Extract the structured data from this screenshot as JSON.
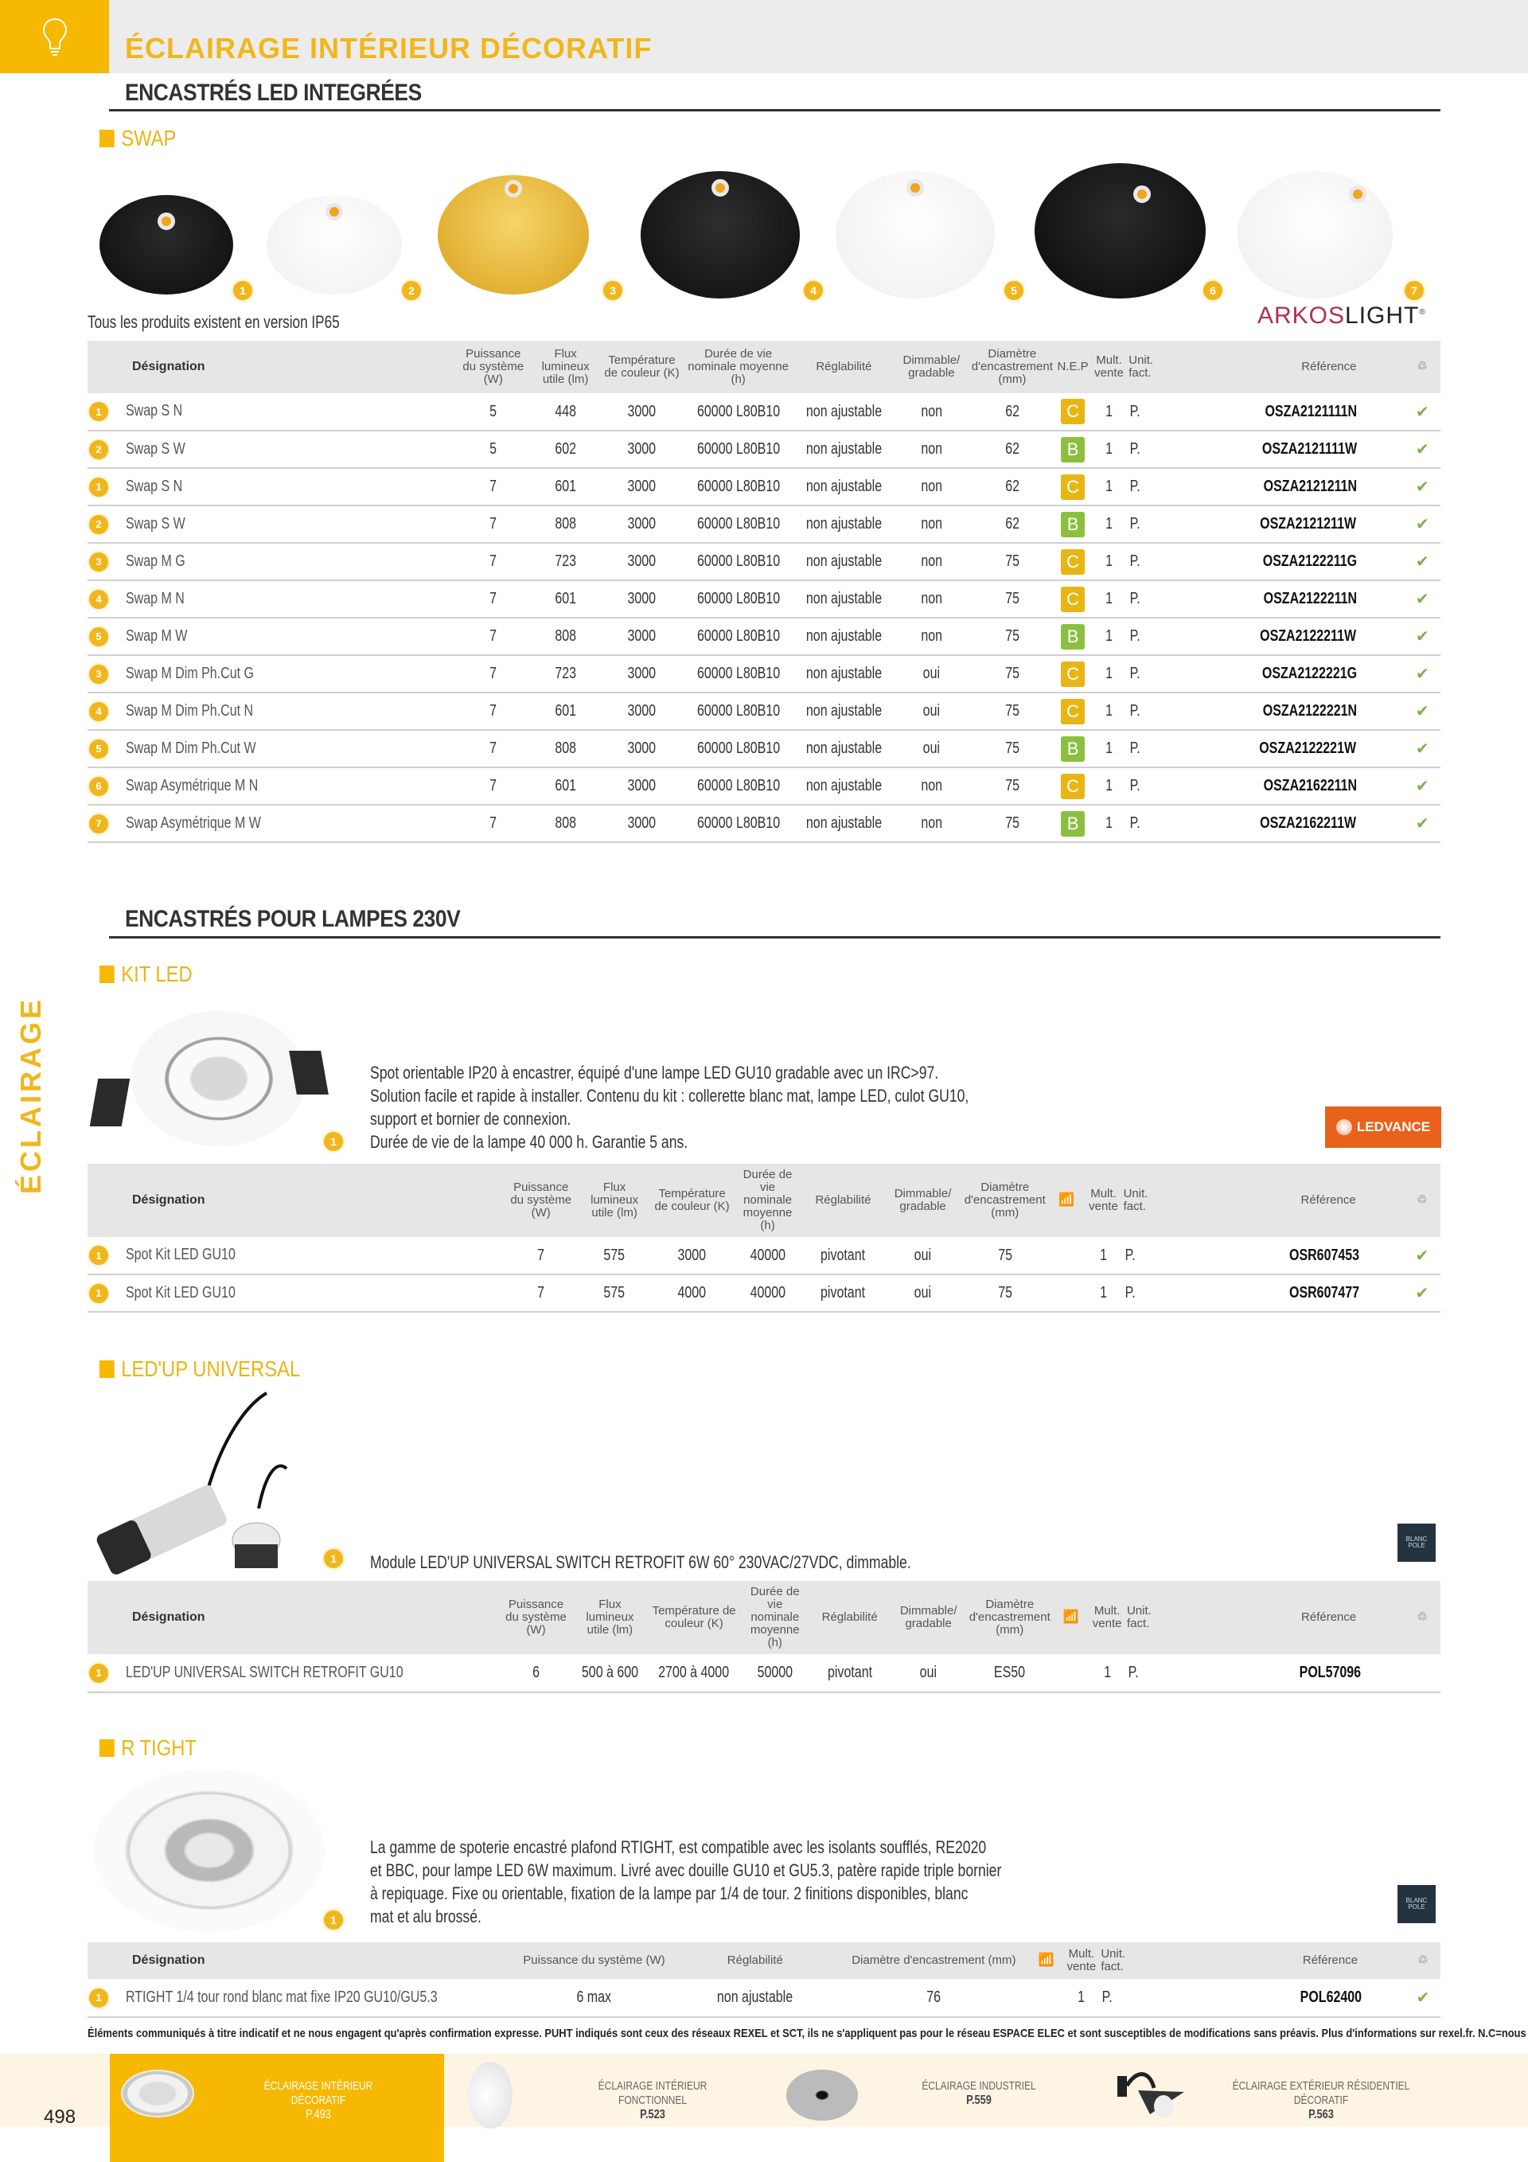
{
  "header": {
    "title": "ÉCLAIRAGE INTÉRIEUR DÉCORATIF",
    "icon": "lightbulb-icon",
    "side_label": "ÉCLAIRAGE"
  },
  "section1": {
    "title": "ENCASTRÉS LED INTEGRÉES",
    "swap": {
      "title": "SWAP",
      "brand": "ARKOSLIGHT",
      "brand_part1": "ARKOS",
      "brand_part2": "LIGHT",
      "note": "Tous les produits existent en version IP65",
      "image_badges": [
        "1",
        "2",
        "3",
        "4",
        "5",
        "6",
        "7"
      ],
      "headers": {
        "designation": "Désignation",
        "power": "Puissance du système (W)",
        "flux": "Flux lumineux utile (lm)",
        "temp": "Température de couleur (K)",
        "life": "Durée de vie nominale moyenne (h)",
        "adjust": "Réglabilité",
        "dim": "Dimmable/ gradable",
        "diam": "Diamètre d'encastrement (mm)",
        "nep": "N.E.P",
        "mult": "Mult. vente",
        "unit": "Unit. fact.",
        "ref": "Référence",
        "stock_icon": "stock-icon"
      },
      "rows": [
        {
          "n": "1",
          "name": "Swap S N",
          "power": "5",
          "flux": "448",
          "temp": "3000",
          "life": "60000 L80B10",
          "adjust": "non ajustable",
          "dim": "non",
          "diam": "62",
          "nep": "C",
          "mult": "1",
          "unit": "P.",
          "ref": "OSZA2121111N",
          "stock": "✔"
        },
        {
          "n": "2",
          "name": "Swap S W",
          "power": "5",
          "flux": "602",
          "temp": "3000",
          "life": "60000 L80B10",
          "adjust": "non ajustable",
          "dim": "non",
          "diam": "62",
          "nep": "B",
          "mult": "1",
          "unit": "P.",
          "ref": "OSZA2121111W",
          "stock": "✔"
        },
        {
          "n": "1",
          "name": "Swap S N",
          "power": "7",
          "flux": "601",
          "temp": "3000",
          "life": "60000 L80B10",
          "adjust": "non ajustable",
          "dim": "non",
          "diam": "62",
          "nep": "C",
          "mult": "1",
          "unit": "P.",
          "ref": "OSZA2121211N",
          "stock": "✔"
        },
        {
          "n": "2",
          "name": "Swap S W",
          "power": "7",
          "flux": "808",
          "temp": "3000",
          "life": "60000 L80B10",
          "adjust": "non ajustable",
          "dim": "non",
          "diam": "62",
          "nep": "B",
          "mult": "1",
          "unit": "P.",
          "ref": "OSZA2121211W",
          "stock": "✔"
        },
        {
          "n": "3",
          "name": "Swap M G",
          "power": "7",
          "flux": "723",
          "temp": "3000",
          "life": "60000 L80B10",
          "adjust": "non ajustable",
          "dim": "non",
          "diam": "75",
          "nep": "C",
          "mult": "1",
          "unit": "P.",
          "ref": "OSZA2122211G",
          "stock": "✔"
        },
        {
          "n": "4",
          "name": "Swap M N",
          "power": "7",
          "flux": "601",
          "temp": "3000",
          "life": "60000 L80B10",
          "adjust": "non ajustable",
          "dim": "non",
          "diam": "75",
          "nep": "C",
          "mult": "1",
          "unit": "P.",
          "ref": "OSZA2122211N",
          "stock": "✔"
        },
        {
          "n": "5",
          "name": "Swap M W",
          "power": "7",
          "flux": "808",
          "temp": "3000",
          "life": "60000 L80B10",
          "adjust": "non ajustable",
          "dim": "non",
          "diam": "75",
          "nep": "B",
          "mult": "1",
          "unit": "P.",
          "ref": "OSZA2122211W",
          "stock": "✔"
        },
        {
          "n": "3",
          "name": "Swap M Dim Ph.Cut  G",
          "power": "7",
          "flux": "723",
          "temp": "3000",
          "life": "60000 L80B10",
          "adjust": "non ajustable",
          "dim": "oui",
          "diam": "75",
          "nep": "C",
          "mult": "1",
          "unit": "P.",
          "ref": "OSZA2122221G",
          "stock": "✔"
        },
        {
          "n": "4",
          "name": "Swap M Dim Ph.Cut  N",
          "power": "7",
          "flux": "601",
          "temp": "3000",
          "life": "60000 L80B10",
          "adjust": "non ajustable",
          "dim": "oui",
          "diam": "75",
          "nep": "C",
          "mult": "1",
          "unit": "P.",
          "ref": "OSZA2122221N",
          "stock": "✔"
        },
        {
          "n": "5",
          "name": "Swap M Dim Ph.Cut W",
          "power": "7",
          "flux": "808",
          "temp": "3000",
          "life": "60000 L80B10",
          "adjust": "non ajustable",
          "dim": "oui",
          "diam": "75",
          "nep": "B",
          "mult": "1",
          "unit": "P.",
          "ref": "OSZA2122221W",
          "stock": "✔"
        },
        {
          "n": "6",
          "name": "Swap Asymétrique M  N",
          "power": "7",
          "flux": "601",
          "temp": "3000",
          "life": "60000 L80B10",
          "adjust": "non ajustable",
          "dim": "non",
          "diam": "75",
          "nep": "C",
          "mult": "1",
          "unit": "P.",
          "ref": "OSZA2162211N",
          "stock": "✔"
        },
        {
          "n": "7",
          "name": "Swap Asymétrique M W",
          "power": "7",
          "flux": "808",
          "temp": "3000",
          "life": "60000 L80B10",
          "adjust": "non ajustable",
          "dim": "non",
          "diam": "75",
          "nep": "B",
          "mult": "1",
          "unit": "P.",
          "ref": "OSZA2162211W",
          "stock": "✔"
        }
      ]
    }
  },
  "section2": {
    "title": "ENCASTRÉS POUR LAMPES 230V",
    "kit_led": {
      "title": "KIT LED",
      "brand": "LEDVANCE",
      "badge": "1",
      "description": [
        "Spot orientable IP20 à encastrer, équipé d'une lampe LED GU10 gradable avec un IRC>97.",
        "Solution facile et rapide à installer. Contenu du kit : collerette blanc mat, lampe LED, culot GU10,",
        "support et bornier de connexion.",
        "Durée de vie de la lampe 40 000 h. Garantie 5 ans."
      ],
      "headers": {
        "designation": "Désignation",
        "power": "Puissance du système (W)",
        "flux": "Flux lumineux utile (lm)",
        "temp": "Température de couleur (K)",
        "life": "Durée de vie nominale moyenne (h)",
        "adjust": "Réglabilité",
        "dim": "Dimmable/ gradable",
        "diam": "Diamètre d'encastrement (mm)",
        "connected_icon": "wifi-icon",
        "mult": "Mult. vente",
        "unit": "Unit. fact.",
        "ref": "Référence",
        "stock_icon": "stock-icon"
      },
      "rows": [
        {
          "n": "1",
          "name": "Spot Kit LED GU10",
          "power": "7",
          "flux": "575",
          "temp": "3000",
          "life": "40000",
          "adjust": "pivotant",
          "dim": "oui",
          "diam": "75",
          "mult": "1",
          "unit": "P.",
          "ref": "OSR607453",
          "stock": "✔"
        },
        {
          "n": "1",
          "name": "Spot Kit LED GU10",
          "power": "7",
          "flux": "575",
          "temp": "4000",
          "life": "40000",
          "adjust": "pivotant",
          "dim": "oui",
          "diam": "75",
          "mult": "1",
          "unit": "P.",
          "ref": "OSR607477",
          "stock": "✔"
        }
      ]
    },
    "ledup": {
      "title": "LED'UP UNIVERSAL",
      "brand": "BLANC POLE",
      "badge": "1",
      "description": "Module LED'UP UNIVERSAL SWITCH RETROFIT 6W 60° 230VAC/27VDC, dimmable.",
      "headers": {
        "designation": "Désignation",
        "power": "Puissance du système (W)",
        "flux": "Flux lumineux utile (lm)",
        "temp": "Température de couleur (K)",
        "life": "Durée de vie nominale moyenne (h)",
        "adjust": "Réglabilité",
        "dim": "Dimmable/ gradable",
        "diam": "Diamètre d'encastrement (mm)",
        "mult": "Mult. vente",
        "unit": "Unit. fact.",
        "ref": "Référence"
      },
      "rows": [
        {
          "n": "1",
          "name": "LED'UP UNIVERSAL SWITCH RETROFIT GU10",
          "power": "6",
          "flux": "500 à 600",
          "temp": "2700 à 4000",
          "life": "50000",
          "adjust": "pivotant",
          "dim": "oui",
          "diam": "ES50",
          "mult": "1",
          "unit": "P.",
          "ref": "POL57096",
          "stock": ""
        }
      ]
    },
    "rtight": {
      "title": "R TIGHT",
      "brand": "BLANC POLE",
      "badge": "1",
      "description": [
        "La gamme de spoterie encastré plafond RTIGHT, est compatible avec les isolants soufflés, RE2020",
        "et BBC, pour lampe LED 6W maximum. Livré avec douille GU10 et GU5.3, patère rapide triple bornier",
        "à repiquage. Fixe ou orientable, fixation de la lampe par 1/4 de tour. 2 finitions disponibles, blanc",
        "mat et alu brossé."
      ],
      "headers": {
        "designation": "Désignation",
        "power": "Puissance du système (W)",
        "adjust": "Réglabilité",
        "diam": "Diamètre d'encastrement (mm)",
        "mult": "Mult. vente",
        "unit": "Unit. fact.",
        "ref": "Référence"
      },
      "rows": [
        {
          "n": "1",
          "name": "RTIGHT 1/4 tour rond blanc mat fixe IP20 GU10/GU5.3",
          "power": "6 max",
          "adjust": "non ajustable",
          "diam": "76",
          "mult": "1",
          "unit": "P.",
          "ref": "POL62400",
          "stock": "✔"
        }
      ]
    }
  },
  "disclaimer": "Éléments communiqués à titre indicatif et ne nous engagent qu'après confirmation expresse. PUHT indiqués sont ceux des réseaux REXEL et SCT, ils ne s'appliquent pas pour le réseau ESPACE ELEC et sont susceptibles de modifications sans préavis. Plus d'informations sur rexel.fr. N.C=nous consulter.",
  "footer": {
    "page_number": "498",
    "nav": [
      {
        "label": "ÉCLAIRAGE INTÉRIEUR DÉCORATIF",
        "page": "P.493",
        "active": true
      },
      {
        "label": "ÉCLAIRAGE INTÉRIEUR FONCTIONNEL",
        "page": "P.523",
        "active": false
      },
      {
        "label": "ÉCLAIRAGE INDUSTRIEL",
        "page": "P.559",
        "active": false
      },
      {
        "label": "ÉCLAIRAGE EXTÉRIEUR RÉSIDENTIEL DÉCORATIF",
        "page": "P.563",
        "active": false
      }
    ]
  },
  "colors": {
    "accent": "#f6b800",
    "nep_C": "#e8b514",
    "nep_B": "#8cbf3f",
    "check": "#7cb342",
    "ledvance": "#e8621c"
  }
}
